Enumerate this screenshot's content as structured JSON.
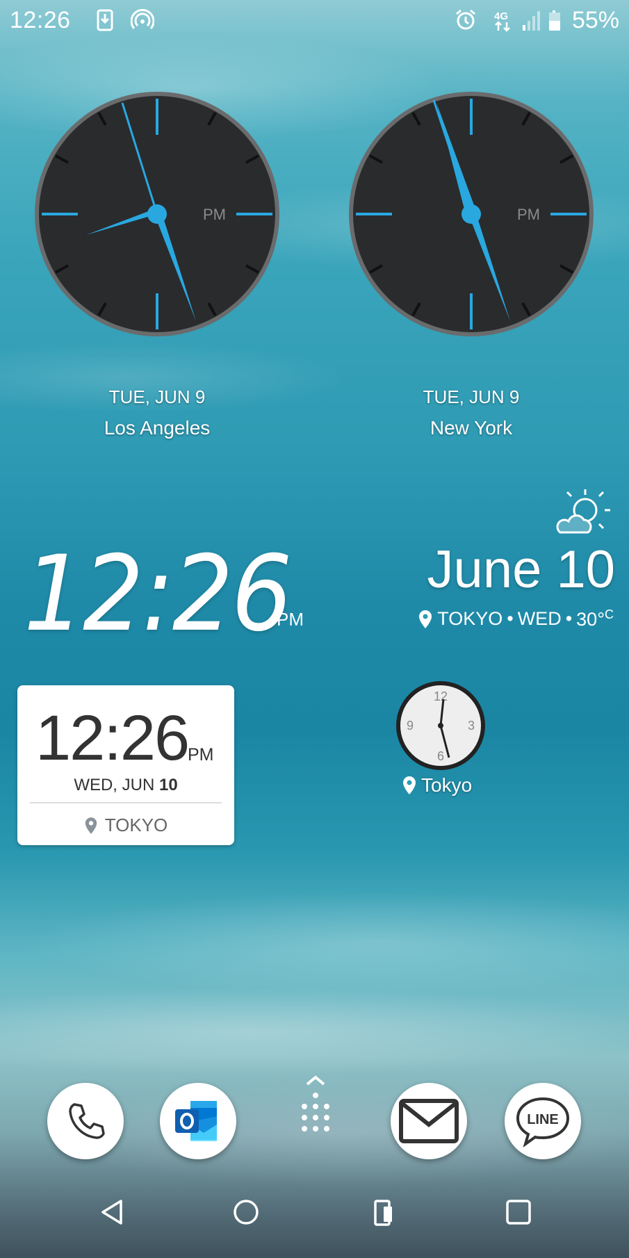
{
  "status_bar": {
    "time": "12:26",
    "battery": "55%",
    "icons": [
      "download-icon",
      "hotspot-icon",
      "alarm-icon",
      "4g-icon",
      "signal-icon",
      "battery-icon"
    ]
  },
  "world_clocks": [
    {
      "date": "TUE, JUN 9",
      "city": "Los Angeles",
      "ampm": "PM"
    },
    {
      "date": "TUE, JUN 9",
      "city": "New York",
      "ampm": "PM"
    }
  ],
  "big_clock": {
    "time": "12:26",
    "ampm": "PM"
  },
  "weather": {
    "date": "June 10",
    "location": "TOKYO",
    "day": "WED",
    "temp": "30°",
    "unit": "C",
    "icon": "partly-sunny-icon"
  },
  "card_widget": {
    "time": "12:26",
    "ampm": "PM",
    "date_prefix": "WED, JUN ",
    "date_day": "10",
    "location": "TOKYO"
  },
  "small_clock": {
    "city": "Tokyo",
    "numerals": [
      "12",
      "3",
      "6",
      "9"
    ]
  },
  "dock": [
    "phone-icon",
    "outlook-icon",
    "app-drawer-icon",
    "mail-icon",
    "line-icon"
  ],
  "nav": [
    "back-icon",
    "home-icon",
    "screen-switch-icon",
    "recents-icon"
  ],
  "colors": {
    "accent": "#29a8e0",
    "clock_face": "#2a2b2d"
  }
}
